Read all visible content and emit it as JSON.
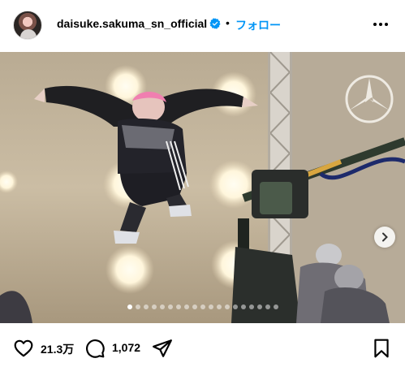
{
  "header": {
    "username": "daisuke.sakuma_sn_official",
    "separator": "•",
    "follow_label": "フォロー"
  },
  "icons": {
    "avatar": "avatar",
    "verified": "verified-badge-icon",
    "more": "more-options-icon",
    "next": "chevron-right-icon",
    "like": "heart-icon",
    "comment": "comment-icon",
    "share": "share-icon",
    "save": "bookmark-icon"
  },
  "carousel": {
    "total_slides": 19,
    "current_slide": 1
  },
  "actions": {
    "likes": "21.3万",
    "comments": "1,072"
  },
  "colors": {
    "follow": "#0095f6",
    "verified": "#0095f6",
    "text": "#000000"
  }
}
